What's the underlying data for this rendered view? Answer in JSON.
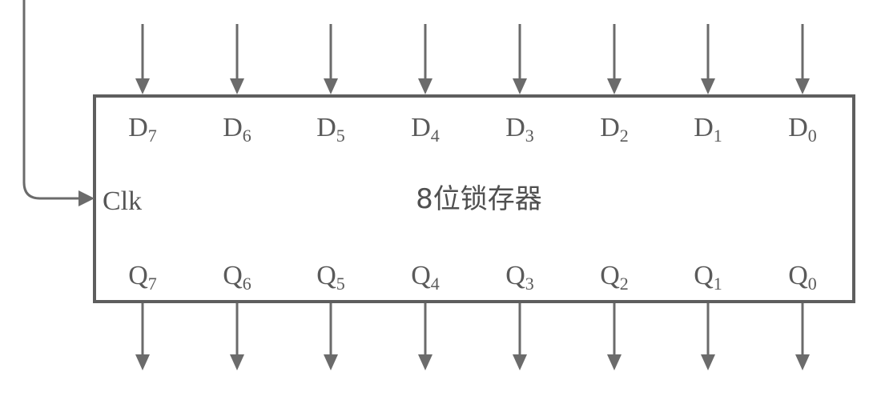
{
  "diagram": {
    "block": {
      "title": "8位锁存器",
      "clock_label": "Clk"
    },
    "inputs": [
      {
        "letter": "D",
        "index": "7"
      },
      {
        "letter": "D",
        "index": "6"
      },
      {
        "letter": "D",
        "index": "5"
      },
      {
        "letter": "D",
        "index": "4"
      },
      {
        "letter": "D",
        "index": "3"
      },
      {
        "letter": "D",
        "index": "2"
      },
      {
        "letter": "D",
        "index": "1"
      },
      {
        "letter": "D",
        "index": "0"
      }
    ],
    "outputs": [
      {
        "letter": "Q",
        "index": "7"
      },
      {
        "letter": "Q",
        "index": "6"
      },
      {
        "letter": "Q",
        "index": "5"
      },
      {
        "letter": "Q",
        "index": "4"
      },
      {
        "letter": "Q",
        "index": "3"
      },
      {
        "letter": "Q",
        "index": "2"
      },
      {
        "letter": "Q",
        "index": "1"
      },
      {
        "letter": "Q",
        "index": "0"
      }
    ],
    "colors": {
      "line": "#6b6b6b",
      "box_border": "#5e5e5e",
      "text": "#555555",
      "background": "#ffffff"
    }
  }
}
